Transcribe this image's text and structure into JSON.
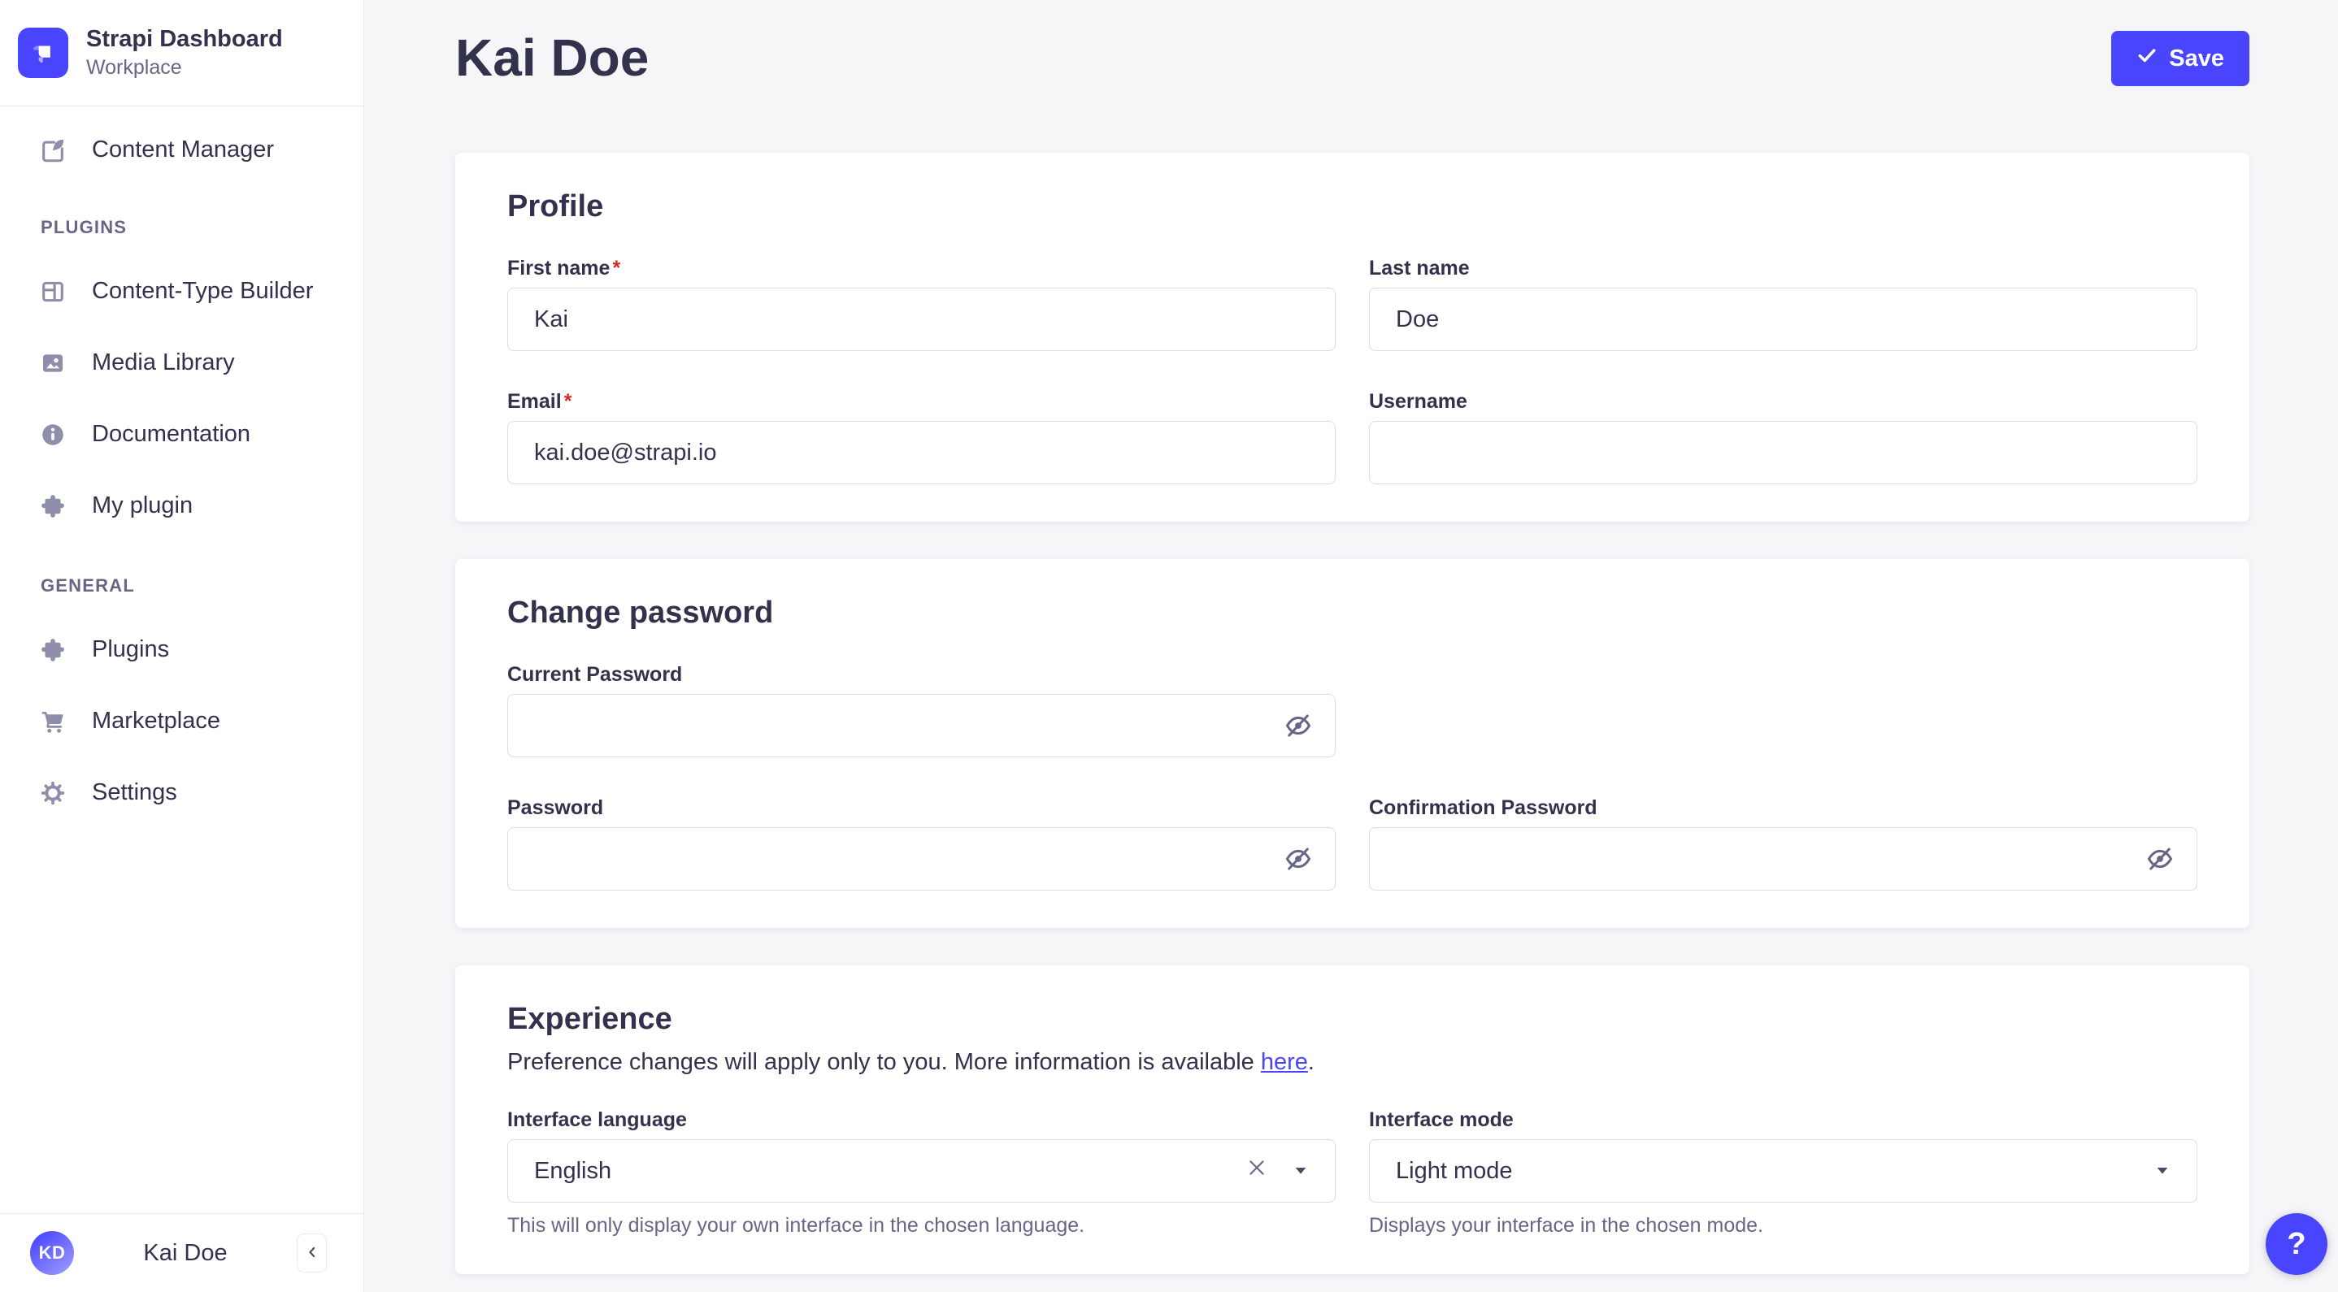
{
  "colors": {
    "primary": "#4945ff",
    "danger": "#d02b20",
    "icon_grey": "#8e8ea9"
  },
  "sidebar": {
    "brand": {
      "title": "Strapi Dashboard",
      "subtitle": "Workplace"
    },
    "sections": {
      "plugins": "PLUGINS",
      "general": "GENERAL"
    },
    "items": [
      {
        "label": "Content Manager",
        "icon": "pen-square-icon"
      },
      {
        "label": "Content-Type Builder",
        "icon": "layout-icon"
      },
      {
        "label": "Media Library",
        "icon": "picture-icon"
      },
      {
        "label": "Documentation",
        "icon": "info-circle-icon"
      },
      {
        "label": "My plugin",
        "icon": "puzzle-icon"
      },
      {
        "label": "Plugins",
        "icon": "puzzle-icon"
      },
      {
        "label": "Marketplace",
        "icon": "cart-icon"
      },
      {
        "label": "Settings",
        "icon": "gear-icon"
      }
    ],
    "footer": {
      "initials": "KD",
      "name": "Kai Doe"
    }
  },
  "header": {
    "title": "Kai Doe",
    "save_label": "Save"
  },
  "profile_card": {
    "heading": "Profile",
    "first_name": {
      "label": "First name",
      "required": "*",
      "value": "Kai"
    },
    "last_name": {
      "label": "Last name",
      "value": "Doe"
    },
    "email": {
      "label": "Email",
      "required": "*",
      "value": "kai.doe@strapi.io"
    },
    "username": {
      "label": "Username",
      "value": ""
    }
  },
  "password_card": {
    "heading": "Change password",
    "current": {
      "label": "Current Password"
    },
    "new": {
      "label": "Password"
    },
    "confirm": {
      "label": "Confirmation Password"
    }
  },
  "experience_card": {
    "heading": "Experience",
    "subtitle_prefix": "Preference changes will apply only to you. More information is available ",
    "subtitle_link": "here",
    "subtitle_suffix": ".",
    "language": {
      "label": "Interface language",
      "value": "English",
      "helper": "This will only display your own interface in the chosen language."
    },
    "mode": {
      "label": "Interface mode",
      "value": "Light mode",
      "helper": "Displays your interface in the chosen mode."
    }
  },
  "help": {
    "label": "?"
  }
}
